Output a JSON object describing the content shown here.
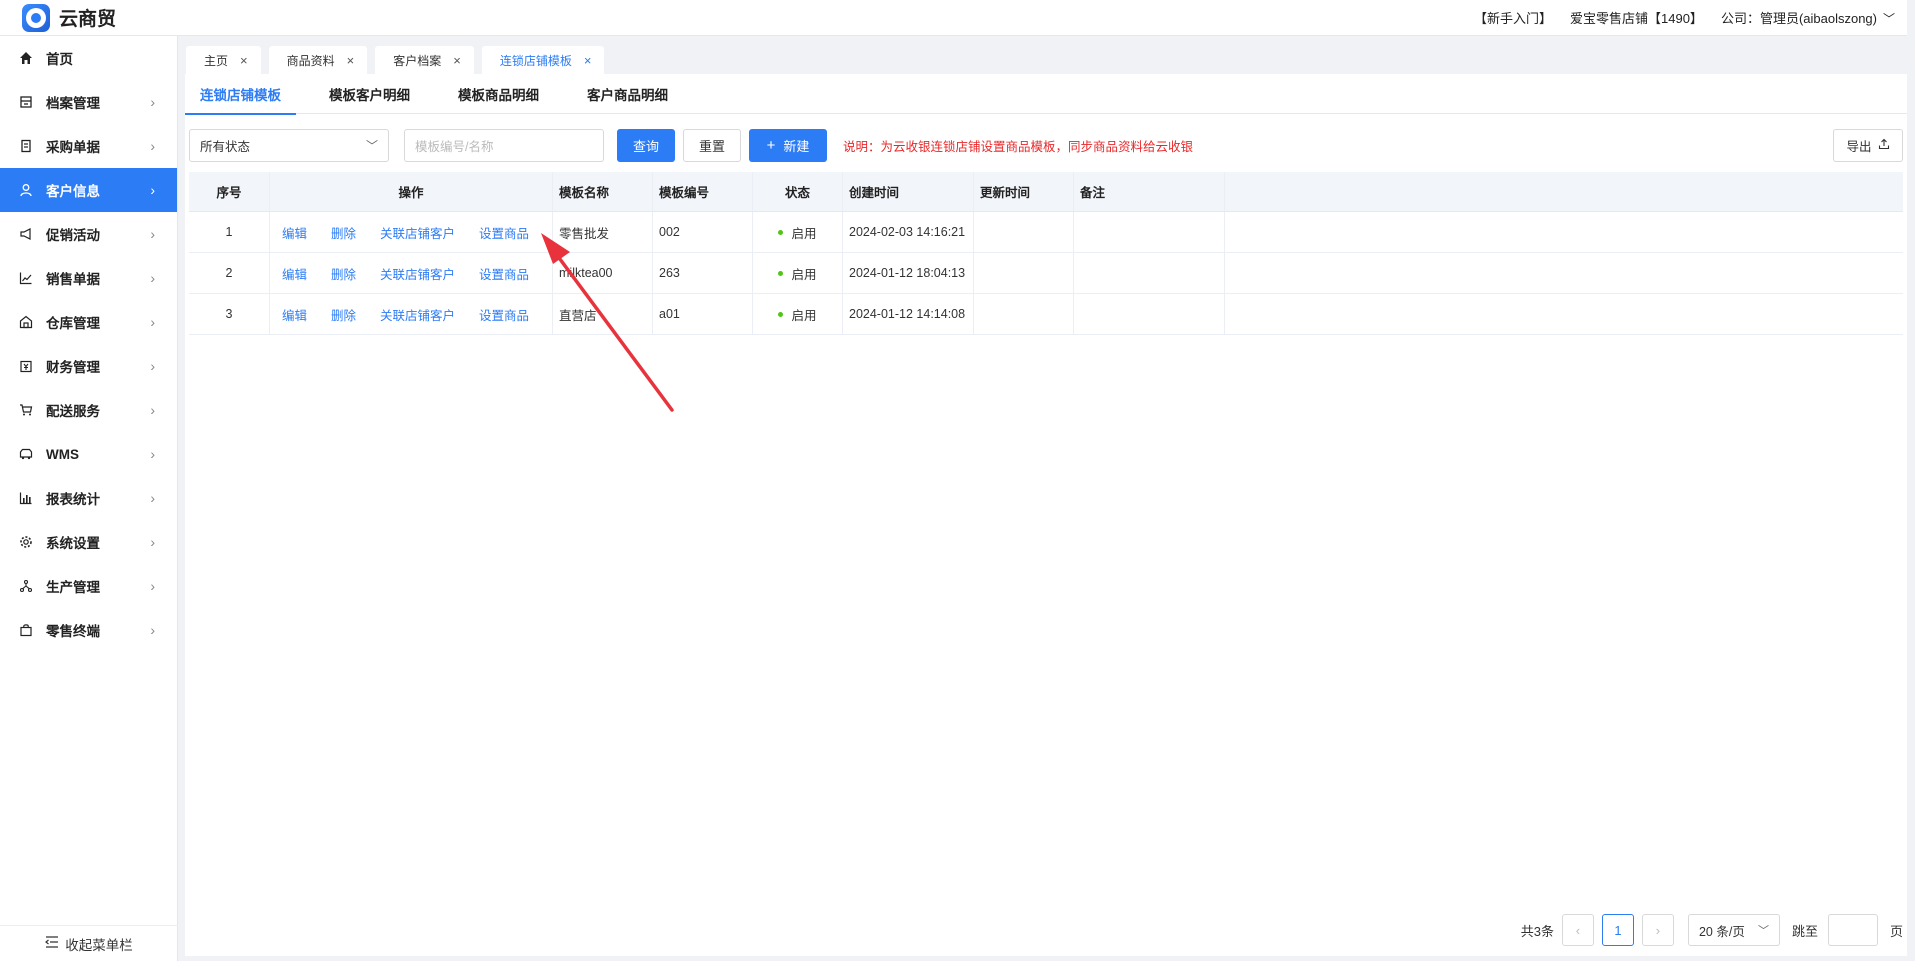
{
  "app": {
    "name": "云商贸"
  },
  "header": {
    "guide": "【新手入门】",
    "store": "爱宝零售店铺【1490】",
    "account": "公司：管理员(aibaolszong)"
  },
  "sidebar": {
    "items": [
      {
        "label": "首页",
        "icon": "home-icon"
      },
      {
        "label": "档案管理",
        "icon": "archive-icon"
      },
      {
        "label": "采购单据",
        "icon": "purchase-doc-icon"
      },
      {
        "label": "客户信息",
        "icon": "user-icon"
      },
      {
        "label": "促销活动",
        "icon": "megaphone-icon"
      },
      {
        "label": "销售单据",
        "icon": "chart-line-icon"
      },
      {
        "label": "仓库管理",
        "icon": "warehouse-icon"
      },
      {
        "label": "财务管理",
        "icon": "finance-icon"
      },
      {
        "label": "配送服务",
        "icon": "cart-icon"
      },
      {
        "label": "WMS",
        "icon": "truck-icon"
      },
      {
        "label": "报表统计",
        "icon": "bar-chart-icon"
      },
      {
        "label": "系统设置",
        "icon": "gear-icon"
      },
      {
        "label": "生产管理",
        "icon": "network-icon"
      },
      {
        "label": "零售终端",
        "icon": "bag-icon"
      }
    ],
    "active_index": 3,
    "collapse_label": "收起菜单栏"
  },
  "page_tabs": [
    {
      "label": "主页"
    },
    {
      "label": "商品资料"
    },
    {
      "label": "客户档案"
    },
    {
      "label": "连锁店铺模板"
    }
  ],
  "sub_tabs": [
    {
      "label": "连锁店铺模板"
    },
    {
      "label": "模板客户明细"
    },
    {
      "label": "模板商品明细"
    },
    {
      "label": "客户商品明细"
    }
  ],
  "toolbar": {
    "status_select": "所有状态",
    "search_placeholder": "模板编号/名称",
    "query": "查询",
    "reset": "重置",
    "new": "新建",
    "notice": "说明：为云收银连锁店铺设置商品模板，同步商品资料给云收银",
    "export": "导出"
  },
  "table": {
    "headers": {
      "idx": "序号",
      "ops": "操作",
      "name": "模板名称",
      "code": "模板编号",
      "status": "状态",
      "created": "创建时间",
      "updated": "更新时间",
      "remark": "备注"
    },
    "op_labels": {
      "edit": "编辑",
      "delete": "删除",
      "link": "关联店铺客户",
      "set": "设置商品"
    },
    "rows": [
      {
        "idx": "1",
        "name": "零售批发",
        "code": "002",
        "status": "启用",
        "created": "2024-02-03 14:16:21",
        "updated": "",
        "remark": ""
      },
      {
        "idx": "2",
        "name": "milktea00",
        "code": "263",
        "status": "启用",
        "created": "2024-01-12 18:04:13",
        "updated": "",
        "remark": ""
      },
      {
        "idx": "3",
        "name": "直营店",
        "code": "a01",
        "status": "启用",
        "created": "2024-01-12 14:14:08",
        "updated": "",
        "remark": ""
      }
    ]
  },
  "pagination": {
    "total": "共3条",
    "current": "1",
    "page_size": "20 条/页",
    "jump_label": "跳至",
    "page_suffix": "页"
  },
  "colors": {
    "accent": "#2c7cf6",
    "notice": "#e8292b",
    "status_on": "#52c41a",
    "annotation": "#e8333c"
  }
}
